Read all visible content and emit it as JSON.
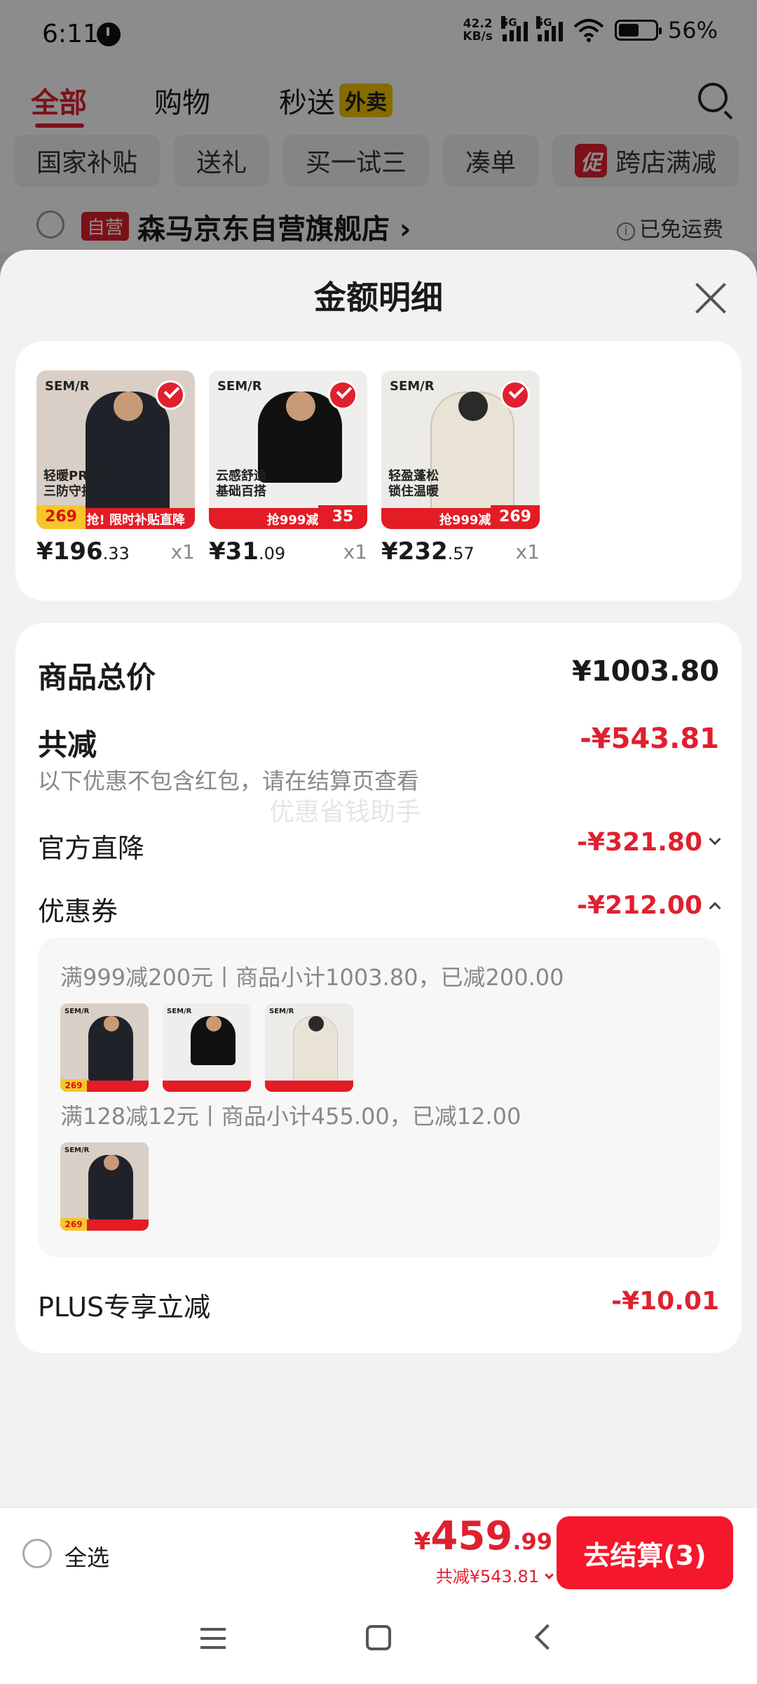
{
  "status_bar": {
    "time": "6:11",
    "net_speed_value": "42.2",
    "net_speed_unit": "KB/s",
    "sim1": "5G",
    "sim2": "5G",
    "battery": "56%"
  },
  "top_tabs": [
    {
      "label": "全部"
    },
    {
      "label": "购物"
    },
    {
      "label": "秒送"
    }
  ],
  "takeout_badge": "外卖",
  "filter_chips": [
    {
      "label": "国家补贴"
    },
    {
      "label": "送礼"
    },
    {
      "label": "买一试三"
    },
    {
      "label": "凑单"
    },
    {
      "label": "跨店满减"
    }
  ],
  "promo_badge": "促",
  "store": {
    "badge": "自营",
    "name": "森马京东自营旗舰店 ›",
    "shipping": "已免运费"
  },
  "sheet": {
    "title": "金额明细",
    "watermark": "优惠省钱助手"
  },
  "products": [
    {
      "brand": "SEM/R",
      "tag1": "轻暖PRO+",
      "tag2": "三防守护",
      "badge": "269",
      "strip": "抢! 限时补贴直降",
      "price_int": "¥196",
      "price_dec": ".33",
      "qty": "x1"
    },
    {
      "brand": "SEM/R",
      "tag1": "云感舒适",
      "tag2": "基础百搭",
      "badge": "35",
      "strip": "抢999减200券",
      "price_int": "¥31",
      "price_dec": ".09",
      "qty": "x1"
    },
    {
      "brand": "SEM/R",
      "tag1": "轻盈蓬松",
      "tag2": "锁住温暖",
      "badge": "269",
      "strip": "抢999减200券",
      "price_int": "¥232",
      "price_dec": ".57",
      "qty": "x1"
    }
  ],
  "summary": {
    "total_label": "商品总价",
    "total_value": "¥1003.80",
    "reduce_label": "共减",
    "reduce_value": "-¥543.81",
    "note": "以下优惠不包含红包，请在结算页查看",
    "official_label": "官方直降",
    "official_value": "-¥321.80",
    "coupon_label": "优惠券",
    "coupon_value": "-¥212.00",
    "coupon_rule_1": "满999减200元丨商品小计1003.80，已减200.00",
    "coupon_rule_2": "满128减12元丨商品小计455.00，已减12.00",
    "plus_label": "PLUS专享立减",
    "plus_value": "-¥10.01"
  },
  "checkout": {
    "select_all": "全选",
    "currency": "¥",
    "price_int": "459",
    "price_dec": ".99",
    "reduce_text": "共减¥543.81",
    "button": "去结算(3)"
  },
  "colors": {
    "accent_red": "#e0202e",
    "button_red": "#f5172b",
    "takeout_yellow": "#f3c400"
  },
  "icons": [
    "clock-icon",
    "wifi-icon",
    "battery-icon",
    "search-icon",
    "info-icon",
    "close-icon",
    "check-icon",
    "chevron-down-icon",
    "chevron-up-icon",
    "menu-icon",
    "home-icon",
    "back-icon"
  ]
}
